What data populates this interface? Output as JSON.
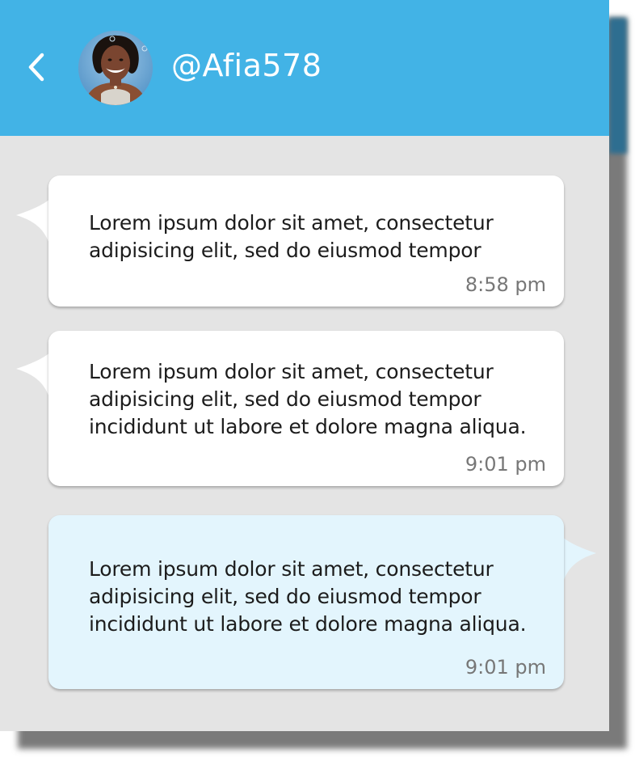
{
  "header": {
    "username": "@Afia578",
    "background": "#42b3e6",
    "back_icon": "chevron-left-icon"
  },
  "messages": [
    {
      "direction": "incoming",
      "text": "Lorem ipsum dolor sit amet, consectetur\nadipisicing elit, sed do eiusmod tempor",
      "time": "8:58 pm"
    },
    {
      "direction": "incoming",
      "text": "Lorem ipsum dolor sit amet, consectetur\nadipisicing elit, sed do eiusmod tempor\nincididunt ut labore et dolore magna aliqua.",
      "time": "9:01 pm"
    },
    {
      "direction": "outgoing",
      "text": "Lorem ipsum dolor sit amet, consectetur\nadipisicing elit, sed do eiusmod tempor\nincididunt ut labore et dolore magna aliqua.",
      "time": "9:01 pm"
    }
  ],
  "colors": {
    "chat_background": "#e4e4e4",
    "incoming_bubble": "#ffffff",
    "outgoing_bubble": "#e3f5fd",
    "timestamp": "#777777"
  }
}
